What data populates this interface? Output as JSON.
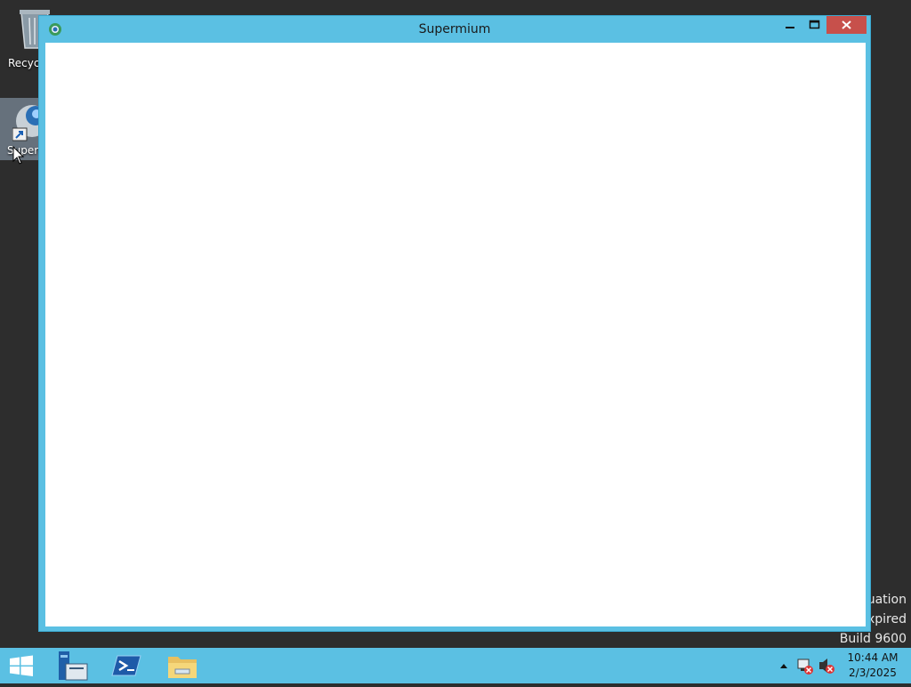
{
  "desktop": {
    "icons": [
      {
        "label": "Recycl"
      },
      {
        "label": "Superm"
      }
    ],
    "watermark": [
      "uation",
      "xpired",
      "Build 9600"
    ]
  },
  "window": {
    "title": "Supermium",
    "controls": {
      "minimize": "minimize",
      "maximize": "maximize",
      "close": "close"
    }
  },
  "taskbar": {
    "clock_time": "10:44 AM",
    "clock_date": "2/3/2025",
    "pinned": [
      "start-icon",
      "server-manager-icon",
      "powershell-icon",
      "file-explorer-icon"
    ],
    "tray": [
      "show-hidden-icons-arrow",
      "network-icon",
      "volume-muted-icon"
    ]
  },
  "colors": {
    "accent": "#5bc0e3",
    "close": "#c7504b",
    "desktop": "#2d2d2d"
  }
}
